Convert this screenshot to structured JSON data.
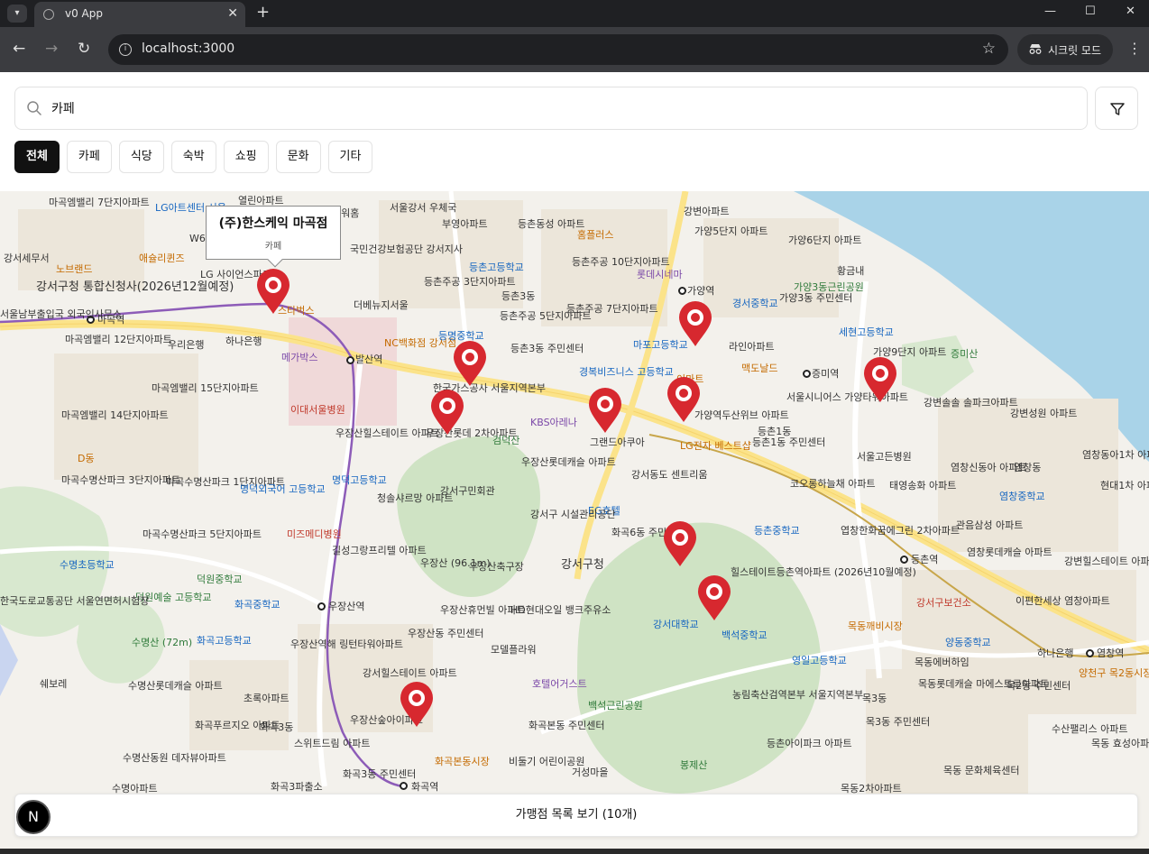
{
  "browser": {
    "tab_title": "v0 App",
    "url": "localhost:3000",
    "incognito_label": "시크릿 모드"
  },
  "search": {
    "value": "카페",
    "placeholder": ""
  },
  "categories": [
    {
      "label": "전체",
      "active": true
    },
    {
      "label": "카페",
      "active": false
    },
    {
      "label": "식당",
      "active": false
    },
    {
      "label": "숙박",
      "active": false
    },
    {
      "label": "쇼핑",
      "active": false
    },
    {
      "label": "문화",
      "active": false
    },
    {
      "label": "기타",
      "active": false
    }
  ],
  "popup": {
    "title": "(주)한스케익 마곡점",
    "category": "카페"
  },
  "list_button": "가맹점 목록 보기 (10개)",
  "next_badge": "N",
  "colors": {
    "pin": "#d7282f",
    "accent": "#111111",
    "water": "#a9d3e8",
    "park": "#cfe3c4",
    "road": "#fbe38a"
  },
  "map_labels": [
    "마곡엠밸리 7단지아파트",
    "LG아트센터 서울",
    "W6",
    "LG 사이언스파크",
    "강서세무서",
    "노브랜드",
    "애슐리퀸즈",
    "강서구청 통합신청사(2026년12월예정)",
    "서울남부출입국 외국인사무소",
    "마곡역",
    "마곡엠밸리 12단지아파트",
    "우리은행",
    "하나은행",
    "메가박스",
    "스타벅스",
    "발산역",
    "이대서울병원",
    "마곡엠밸리 15단지아파트",
    "마곡엠밸리 14단지아파트",
    "D동",
    "마곡수명산파크 3단지아파트",
    "마곡수명산파크 1단지아파트",
    "명덕외국어 고등학교",
    "명덕고등학교",
    "미즈메디병원",
    "마곡수명산파크 5단지아파트",
    "수명초등학교",
    "덕원중학교",
    "덕원예술 고등학교",
    "화곡중학교",
    "화곡고등학교",
    "수명산 (72m)",
    "우장산역",
    "한국도로교통공단 서울연면허시험장",
    "쉐보레",
    "수명산롯데캐슬 아파트",
    "화곡푸르지오 아파트",
    "초록아파트",
    "화곡3동",
    "수명산동원 데자뷰아파트",
    "수명아파트",
    "스위트드림 아파트",
    "화곡3동 주민센터",
    "화곡3파출소",
    "화곡역",
    "강서힐스테이트 아파트",
    "우장산숲아이파크",
    "우장산역해 링턴타워아파트",
    "우장산동 주민센터",
    "우장산휴먼빌 아파트",
    "HD현대오일 뱅크주유소",
    "모델플라워",
    "호텔어거스트",
    "백석근린공원",
    "화곡본동 주민센터",
    "화곡본동시장",
    "비둘기 어린이공원",
    "거성마을",
    "봉제산",
    "우장산 (96.1m)",
    "우장산축구장",
    "길성그랑프리텔 아파트",
    "청솔샤르망 아파트",
    "강서구민회관",
    "우장산힐스테이트 아파트",
    "우장산롯데 2차아파트",
    "검덕산",
    "우장산롯데캐슬 아파트",
    "한국가스공사 서울지역본부",
    "KBS아레나",
    "그랜드아쿠아",
    "강서동도 센트리움",
    "EG호텔",
    "강서구 시설관리공단",
    "화곡6동 주민센터",
    "강서구청",
    "강서대학교",
    "백석중학교",
    "영일고등학교",
    "농림축산검역본부 서울지역본부",
    "등촌아이파크 아파트",
    "힐스테이트등촌역아파트 (2026년10월예정)",
    "등촌중학교",
    "코오롱하늘채 아파트",
    "엽창한화꿈에그린 2차아파트",
    "등촌역",
    "강서구보건소",
    "목동깨비시장",
    "양동중학교",
    "목동롯데캐슬 마에스트로아파트",
    "목동에버하임",
    "목3동",
    "목3동 주민센터",
    "목동 문화체육센터",
    "목동2차아파트",
    "이편한세상 염창아파트",
    "하나은행",
    "염창역",
    "양천구 목2동시장",
    "목2동 주민센터",
    "수산팰리스 아파트",
    "목동 효성아파트",
    "강변힐스테이트 아파트",
    "관음삼성 아파트",
    "염창롯데캐슬 아파트",
    "염창동",
    "염창중학교",
    "염창신동아 아파트",
    "태영송화 아파트",
    "서울고든병원",
    "현대1차 아파트",
    "염창동아1차 아파트",
    "강변성원 아파트",
    "강변솔솔 솔파크아파트",
    "증미산",
    "증미역",
    "가양9단지 아파트",
    "세현고등학교",
    "가양3동 주민센터",
    "가양3동근린공원",
    "황금내",
    "가양6단지 아파트",
    "가양5단지 아파트",
    "강변아파트",
    "경서중학교",
    "가양역",
    "라인아파트",
    "맥도날드",
    "서울시니어스 가양타워아파트",
    "가양역두산위브 아파트",
    "LG전자 베스트샵",
    "등촌1동 주민센터",
    "등촌1동",
    "이마트",
    "경복비즈니스 고등학교",
    "마포고등학교",
    "롯데시네마",
    "등촌주공 7단지아파트",
    "등촌주공 10단지아파트",
    "홈플러스",
    "등촌동성 아파트",
    "등촌고등학교",
    "부영아파트",
    "서울강서 우체국",
    "아워홈",
    "국민건강보험공단 강서지사",
    "등촌주공 3단지아파트",
    "등촌3동",
    "등촌주공 5단지아파트",
    "더베뉴지서울",
    "NC백화점 강서점",
    "등명중학교",
    "등촌3동 주민센터",
    "열린아파트"
  ]
}
